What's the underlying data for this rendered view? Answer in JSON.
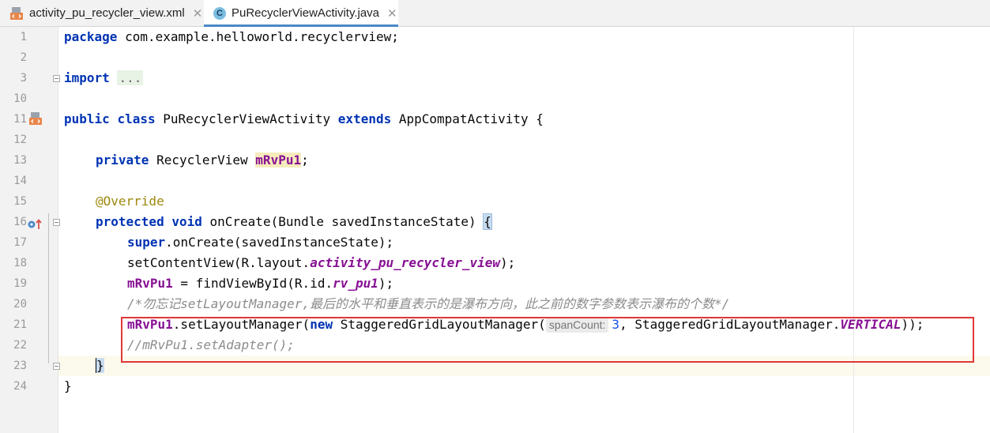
{
  "tabs": [
    {
      "label": "activity_pu_recycler_view.xml",
      "icon": "xml-file-icon",
      "active": false
    },
    {
      "label": "PuRecyclerViewActivity.java",
      "icon": "java-class-icon",
      "active": true
    }
  ],
  "close_glyph": "✕",
  "java_icon_letter": "C",
  "line_numbers": [
    "1",
    "2",
    "3",
    "10",
    "11",
    "12",
    "13",
    "14",
    "15",
    "16",
    "17",
    "18",
    "19",
    "20",
    "21",
    "22",
    "23",
    "24"
  ],
  "code": {
    "l1_kw": "package",
    "l1_rest": " com.example.helloworld.recyclerview;",
    "l3_kw": "import",
    "l3_dots": "...",
    "l11_kw1": "public",
    "l11_kw2": "class",
    "l11_name": " PuRecyclerViewActivity ",
    "l11_kw3": "extends",
    "l11_rest": " AppCompatActivity {",
    "l13_kw": "private",
    "l13_type": " RecyclerView ",
    "l13_field": "mRvPu1",
    "l13_end": ";",
    "l15_ann": "@Override",
    "l16_kw1": "protected",
    "l16_kw2": "void",
    "l16_rest": " onCreate(Bundle savedInstanceState) ",
    "l16_brace": "{",
    "l17_kw": "super",
    "l17_rest": ".onCreate(savedInstanceState);",
    "l18_pre": "setContentView(R.layout.",
    "l18_res": "activity_pu_recycler_view",
    "l18_end": ");",
    "l19_field": "mRvPu1",
    "l19_mid": " = findViewById(R.id.",
    "l19_res": "rv_pu1",
    "l19_end": ");",
    "l20_comment": "/*勿忘记setLayoutManager,最后的水平和垂直表示的是瀑布方向，此之前的数字参数表示瀑布的个数*/",
    "l21_field": "mRvPu1",
    "l21_mid": ".setLayoutManager(",
    "l21_kw": "new",
    "l21_type": " StaggeredGridLayoutManager(",
    "l21_hint": "spanCount:",
    "l21_num": "3",
    "l21_rest": ", StaggeredGridLayoutManager.",
    "l21_const": "VERTICAL",
    "l21_end": "));",
    "l22_comment": "//mRvPu1.setAdapter();",
    "l23_brace": "}",
    "l24_brace": "}"
  },
  "colors": {
    "keyword": "#0033b3",
    "field": "#871094",
    "comment": "#8c8c8c",
    "annotation": "#9e880d",
    "highlight_box": "#e03838",
    "tab_accent": "#4a88c7"
  }
}
